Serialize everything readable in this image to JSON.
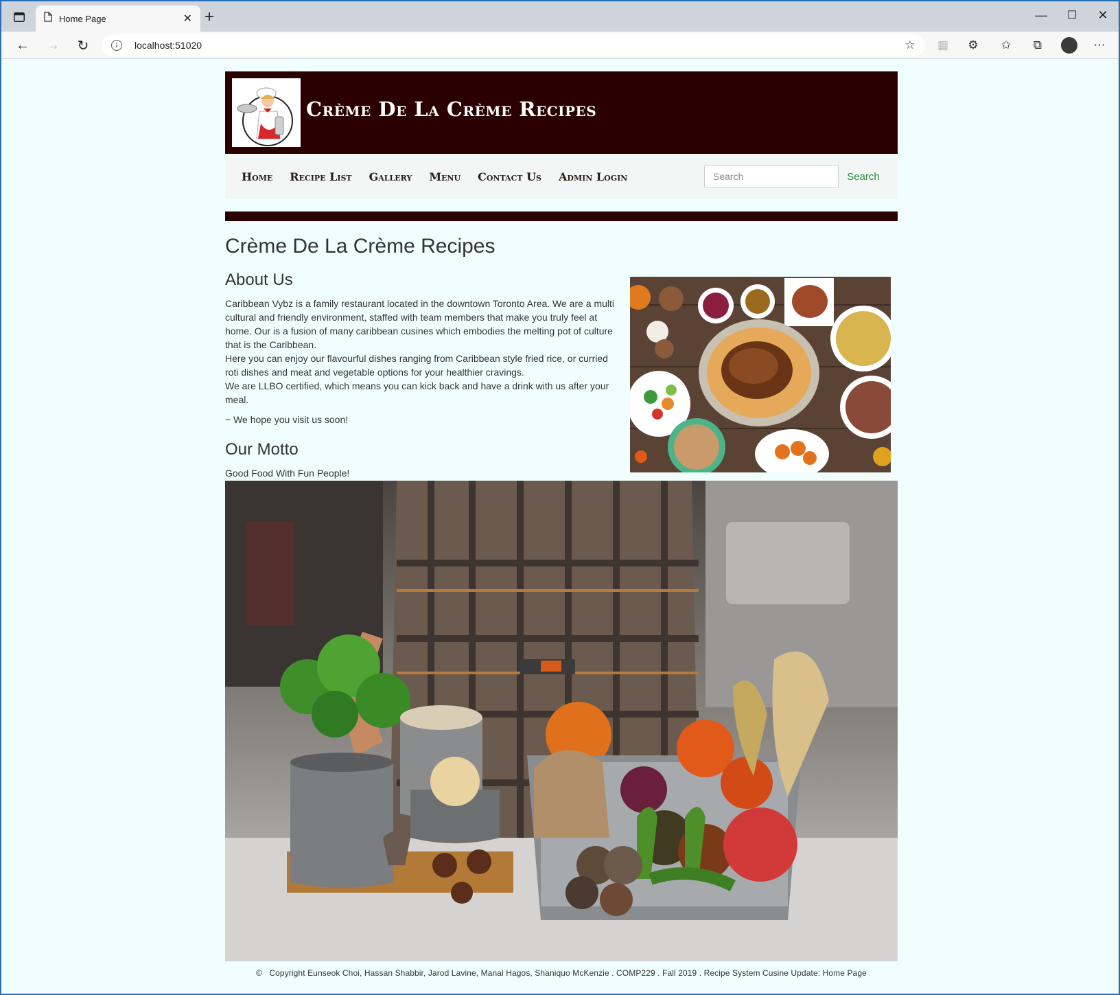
{
  "browser": {
    "tab_title": "Home Page",
    "url": "localhost:51020"
  },
  "site": {
    "brand": "Crème De La Crème Recipes",
    "nav": [
      "Home",
      "Recipe List",
      "Gallery",
      "Menu",
      "Contact Us",
      "Admin Login"
    ],
    "search_placeholder": "Search",
    "search_button": "Search"
  },
  "main": {
    "title": "Crème De La Crème Recipes",
    "about_heading": "About Us",
    "about_p1": "Caribbean Vybz is a family restaurant located in the downtown Toronto Area. We are a multi cultural and friendly environment, staffed with team members that make you truly feel at home. Our is a fusion of many caribbean cusines which embodies the melting pot of culture that is the Caribbean.",
    "about_p2": "Here you can enjoy our flavourful dishes ranging from Caribbean style fried rice, or curried roti dishes and meat and vegetable options for your healthier cravings.",
    "about_p3": "We are LLBO certified, which means you can kick back and have a drink with us after your meal.",
    "signoff": "~ We hope you visit us soon!",
    "motto_heading": "Our Motto",
    "motto": "Good Food With Fun People!"
  },
  "footer": {
    "copyright_symbol": "©",
    "text": "Copyright Eunseok Choi, Hassan Shabbir, Jarod Lavine, Manal Hagos, Shaniquo McKenzie . COMP229 . Fall 2019 . Recipe System Cusine Update: Home Page"
  },
  "colors": {
    "banner": "#2b0000",
    "page_bg": "#f0fffe",
    "search_green": "#2e8b3a"
  }
}
